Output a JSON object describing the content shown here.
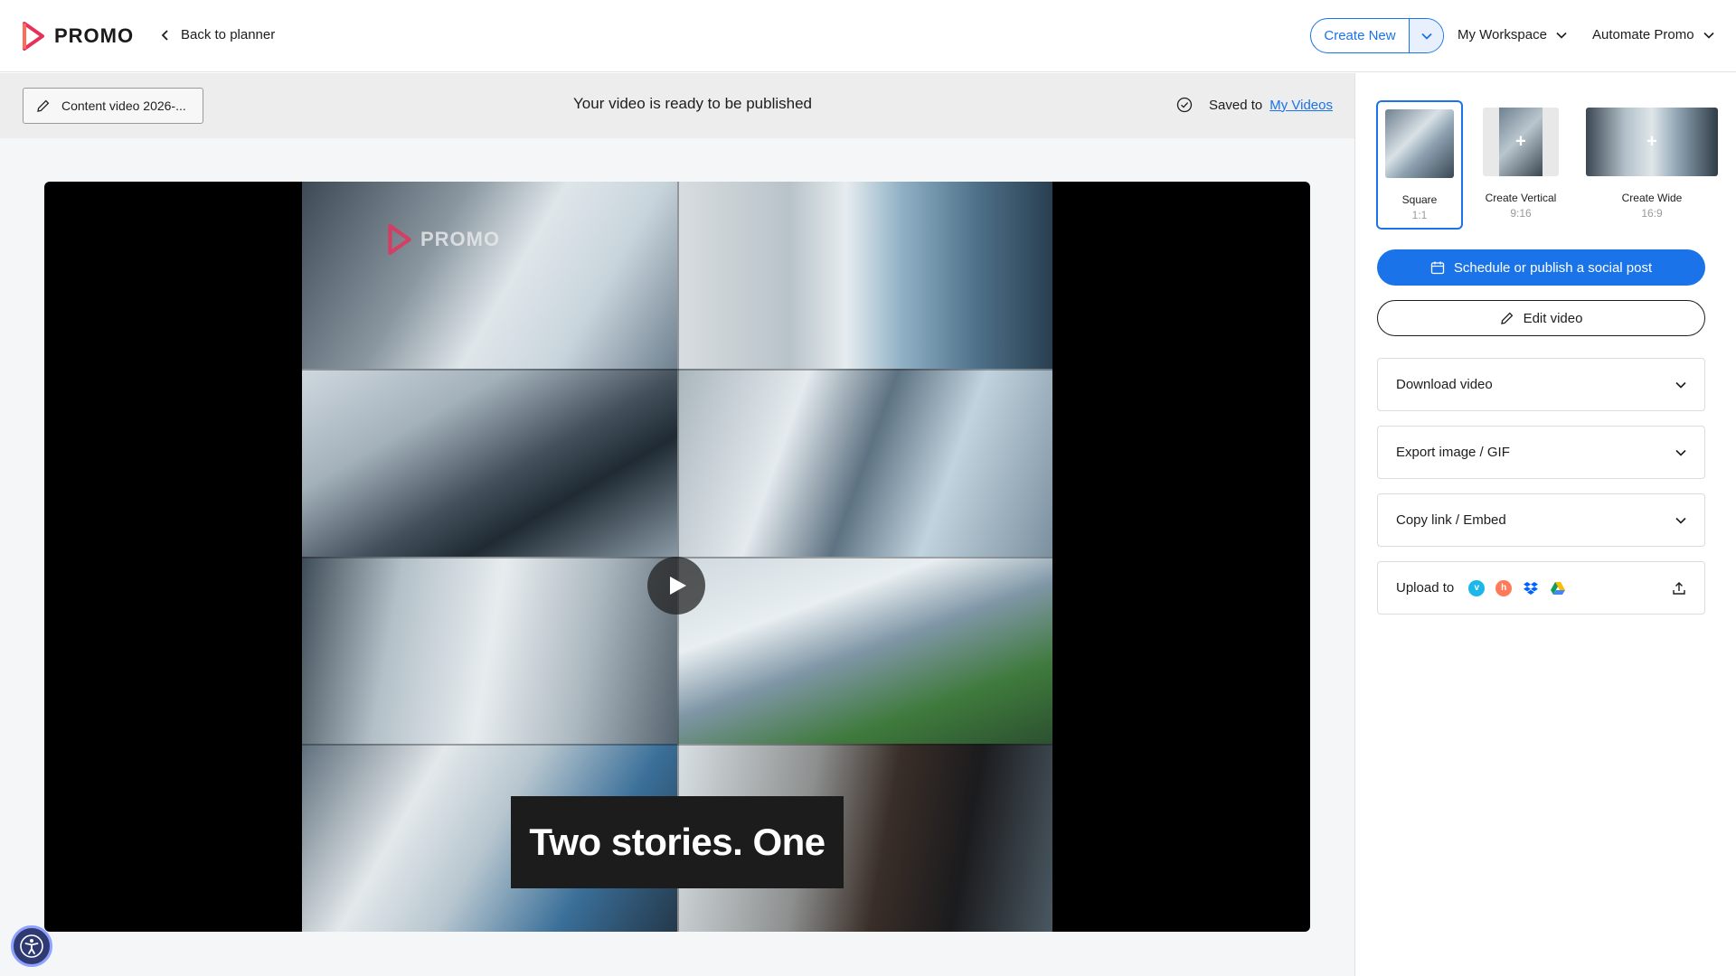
{
  "header": {
    "logo_text": "PROMO",
    "back_label": "Back to planner",
    "create_new_label": "Create New",
    "workspace_label": "My Workspace",
    "automate_label": "Automate Promo"
  },
  "topbar": {
    "video_title": "Content video 2026-...",
    "status_text": "Your video is ready to be published",
    "saved_prefix": "Saved to",
    "saved_link": "My Videos"
  },
  "player": {
    "watermark": "PROMO",
    "caption": "Two stories. One"
  },
  "formats": [
    {
      "label": "Square",
      "ratio": "1:1",
      "active": true
    },
    {
      "label": "Create Vertical",
      "ratio": "9:16",
      "active": false
    },
    {
      "label": "Create Wide",
      "ratio": "16:9",
      "active": false
    }
  ],
  "actions": {
    "schedule_label": "Schedule or publish a social post",
    "edit_label": "Edit video"
  },
  "accordions": [
    {
      "label": "Download video"
    },
    {
      "label": "Export image / GIF"
    },
    {
      "label": "Copy link / Embed"
    }
  ],
  "upload": {
    "label": "Upload to",
    "services": [
      "vimeo-icon",
      "hubspot-icon",
      "dropbox-icon",
      "google-drive-icon"
    ]
  },
  "colors": {
    "accent": "#1a73e8",
    "logo_red": "#e8305a"
  }
}
